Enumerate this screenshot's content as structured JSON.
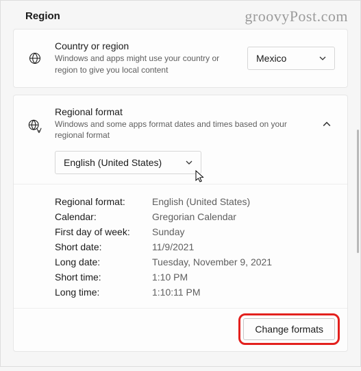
{
  "page": {
    "title": "Region"
  },
  "watermark": "groovyPost.com",
  "country_card": {
    "title": "Country or region",
    "sub": "Windows and apps might use your country or region to give you local content",
    "selected": "Mexico"
  },
  "regional_card": {
    "title": "Regional format",
    "sub": "Windows and some apps format dates and times based on your regional format",
    "selected_format": "English (United States)",
    "details": {
      "regional_format": {
        "label": "Regional format:",
        "value": "English (United States)"
      },
      "calendar": {
        "label": "Calendar:",
        "value": "Gregorian Calendar"
      },
      "first_day": {
        "label": "First day of week:",
        "value": "Sunday"
      },
      "short_date": {
        "label": "Short date:",
        "value": "11/9/2021"
      },
      "long_date": {
        "label": "Long date:",
        "value": "Tuesday, November 9, 2021"
      },
      "short_time": {
        "label": "Short time:",
        "value": "1:10 PM"
      },
      "long_time": {
        "label": "Long time:",
        "value": "1:10:11 PM"
      }
    },
    "change_button": "Change formats"
  }
}
